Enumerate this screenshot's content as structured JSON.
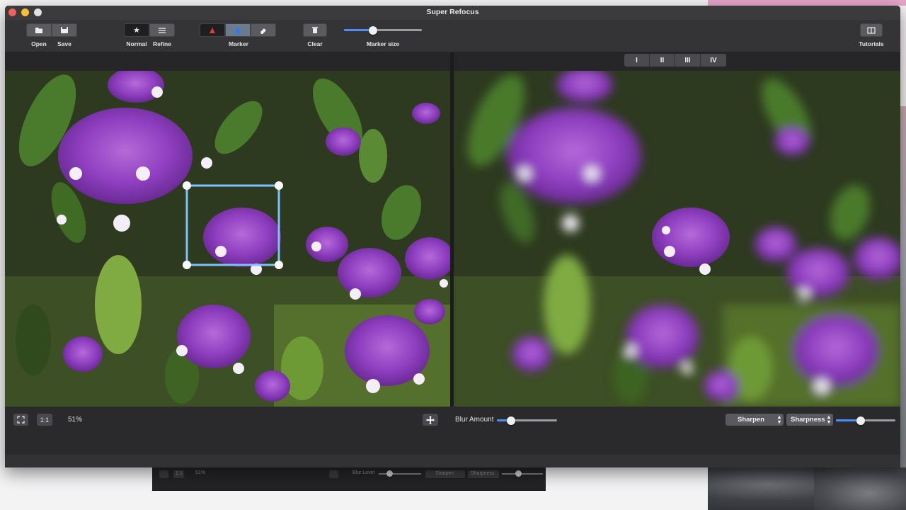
{
  "window": {
    "title": "Super Refocus"
  },
  "toolbar": {
    "open_label": "Open",
    "save_label": "Save",
    "normal_label": "Normal",
    "refine_label": "Refine",
    "marker_label": "Marker",
    "clear_label": "Clear",
    "marker_size_label": "Marker size",
    "marker_size_level": 0.37,
    "tutorials_label": "Tutorials"
  },
  "view_modes": [
    "I",
    "II",
    "III",
    "IV"
  ],
  "left_footer": {
    "fit_icon": "fullscreen-icon",
    "one_to_one": "1:1",
    "zoom": "51%"
  },
  "right_footer": {
    "blur_label": "Blur Amount",
    "blur_level": 0.24,
    "sharpen_select": "Sharpen",
    "sharpness_select": "Sharpness",
    "sharpness_level": 0.42
  },
  "background_window": {
    "one_to_one": "1:1",
    "zoom": "51%",
    "blur_label": "Blur Level",
    "sharpen": "Sharpen",
    "sharpness": "Sharpness"
  },
  "colors": {
    "accent": "#4b8ff7",
    "marker_red": "#e23b3b",
    "marker_blue": "#2e7df0",
    "selection": "#7fc1ff"
  },
  "icons": [
    "open-icon",
    "save-icon",
    "star-icon",
    "refine-icon",
    "marker-red-icon",
    "marker-blue-icon",
    "eraser-icon",
    "trash-icon",
    "tutorials-icon",
    "fullscreen-icon",
    "move-icon"
  ]
}
